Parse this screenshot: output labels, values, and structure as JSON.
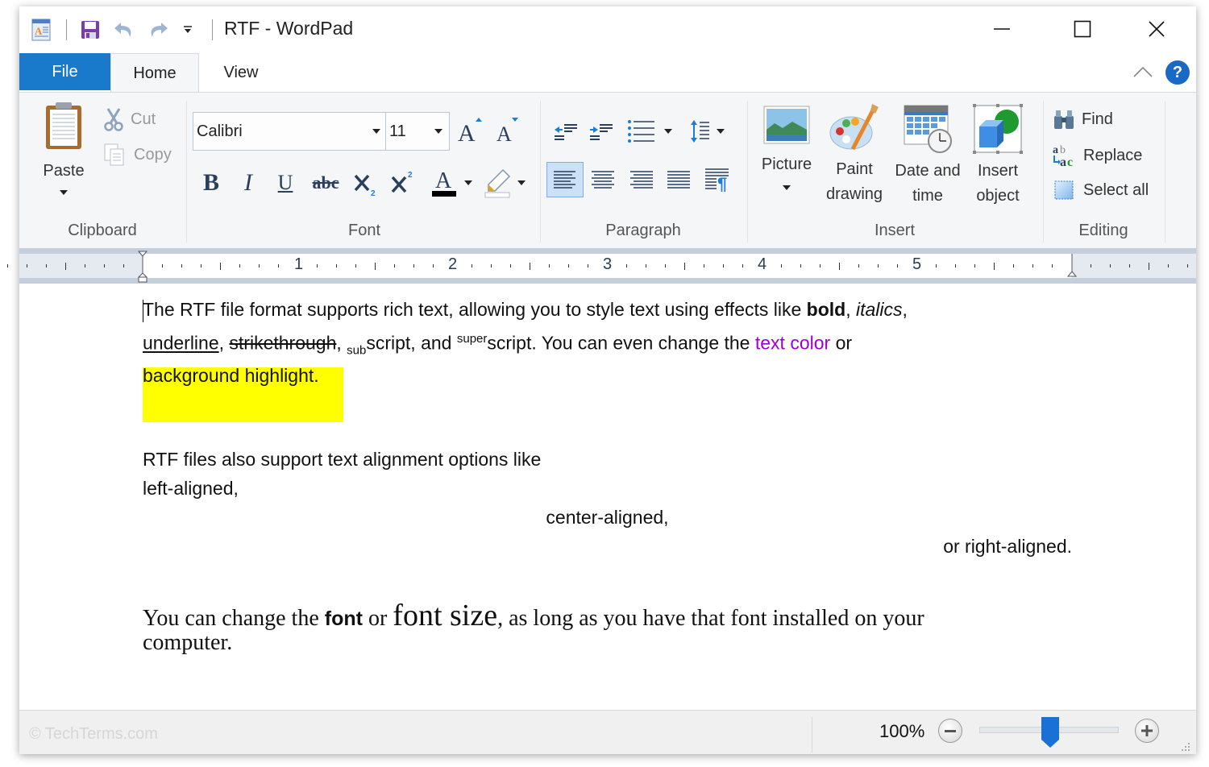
{
  "window": {
    "title": "RTF - WordPad",
    "quick_access": {
      "app_icon": "wordpad-icon",
      "save": "save-icon",
      "undo": "undo-icon",
      "redo": "redo-icon",
      "customize": "customize-quick-access-icon"
    },
    "controls": {
      "minimize": "minimize-icon",
      "maximize": "maximize-icon",
      "close": "close-icon"
    }
  },
  "tabs": {
    "file": "File",
    "home": "Home",
    "view": "View",
    "help": "?"
  },
  "ribbon": {
    "clipboard": {
      "label": "Clipboard",
      "paste": "Paste",
      "cut": "Cut",
      "copy": "Copy"
    },
    "font": {
      "label": "Font",
      "family": "Calibri",
      "size": "11",
      "buttons": [
        "grow-font",
        "shrink-font",
        "bold",
        "italic",
        "underline",
        "strikethrough",
        "subscript",
        "superscript",
        "text-color",
        "highlight-color"
      ],
      "text_color": "#000000"
    },
    "paragraph": {
      "label": "Paragraph",
      "buttons": [
        "decrease-indent",
        "increase-indent",
        "bullets",
        "line-spacing",
        "align-left",
        "align-center",
        "align-right",
        "justify",
        "paragraph-settings"
      ],
      "active_alignment": "align-left"
    },
    "insert": {
      "label": "Insert",
      "picture": "Picture",
      "paint_drawing_1": "Paint",
      "paint_drawing_2": "drawing",
      "date_time_1": "Date and",
      "date_time_2": "time",
      "insert_object_1": "Insert",
      "insert_object_2": "object"
    },
    "editing": {
      "label": "Editing",
      "find": "Find",
      "replace": "Replace",
      "select_all": "Select all"
    }
  },
  "ruler": {
    "numbers": [
      "1",
      "2",
      "3",
      "4",
      "5"
    ]
  },
  "document": {
    "p1": {
      "t1": "The RTF file format supports rich text, allowing you to style text using effects like ",
      "bold": "bold",
      "c1": ", ",
      "italic": "italics",
      "c2": ",",
      "underline": "underline",
      "c3": ", ",
      "strike": "strikethrough",
      "c4": ", ",
      "sub": "sub",
      "t2": "script, and ",
      "sup": "super",
      "t3": "script. You can even change the ",
      "colored": "text color",
      "text_color": "#9b00d3",
      "t4": " or",
      "highlight": "background highlight",
      "highlight_color": "#ffff00",
      "t5": "."
    },
    "p2": {
      "line1": "RTF files also support text alignment options like",
      "left": "left-aligned,",
      "center": "center-aligned,",
      "right": "or right-aligned."
    },
    "p3": {
      "t1": "You can change the ",
      "font": "font",
      "t2": " or ",
      "size": "font size",
      "t3": ", as long as you have that font installed on your",
      "line2": "computer."
    }
  },
  "status": {
    "watermark": "© TechTerms.com",
    "zoom": "100%",
    "zoom_level_percent": 100
  }
}
